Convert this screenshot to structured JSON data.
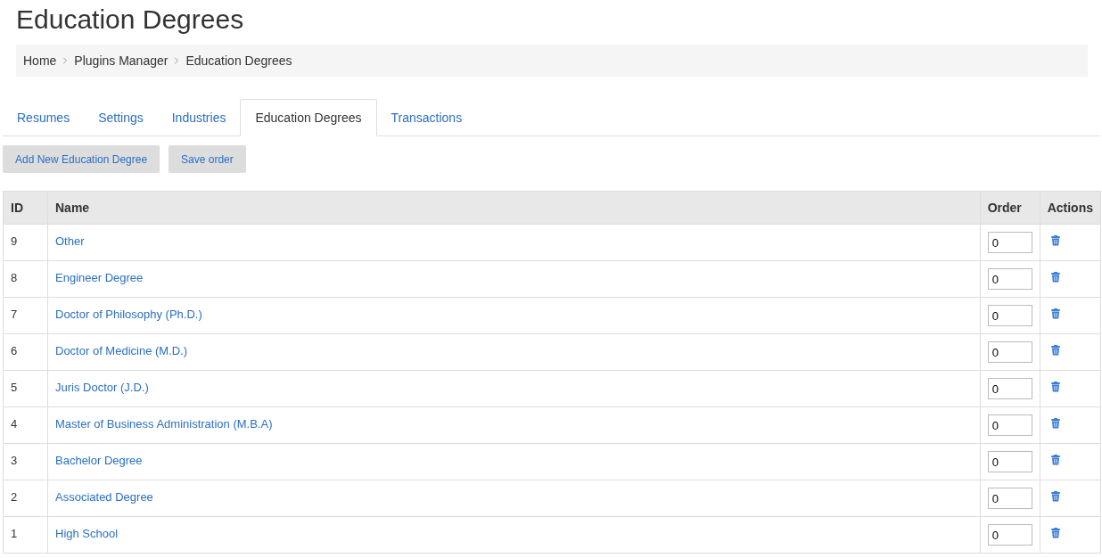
{
  "title": "Education Degrees",
  "breadcrumb": [
    "Home",
    "Plugins Manager",
    "Education Degrees"
  ],
  "tabs": [
    {
      "label": "Resumes",
      "selected": false
    },
    {
      "label": "Settings",
      "selected": false
    },
    {
      "label": "Industries",
      "selected": false
    },
    {
      "label": "Education Degrees",
      "selected": true
    },
    {
      "label": "Transactions",
      "selected": false
    }
  ],
  "buttons": [
    "Add New Education Degree",
    "Save order"
  ],
  "table": {
    "columns": [
      "ID",
      "Name",
      "Order",
      "Actions"
    ],
    "rows": [
      {
        "id": "9",
        "name": "Other",
        "order": "0"
      },
      {
        "id": "8",
        "name": "Engineer Degree",
        "order": "0"
      },
      {
        "id": "7",
        "name": "Doctor of Philosophy (Ph.D.)",
        "order": "0"
      },
      {
        "id": "6",
        "name": "Doctor of Medicine (M.D.)",
        "order": "0"
      },
      {
        "id": "5",
        "name": "Juris Doctor (J.D.)",
        "order": "0"
      },
      {
        "id": "4",
        "name": "Master of Business Administration (M.B.A)",
        "order": "0"
      },
      {
        "id": "3",
        "name": "Bachelor Degree",
        "order": "0"
      },
      {
        "id": "2",
        "name": "Associated Degree",
        "order": "0"
      },
      {
        "id": "1",
        "name": "High School",
        "order": "0"
      }
    ]
  }
}
